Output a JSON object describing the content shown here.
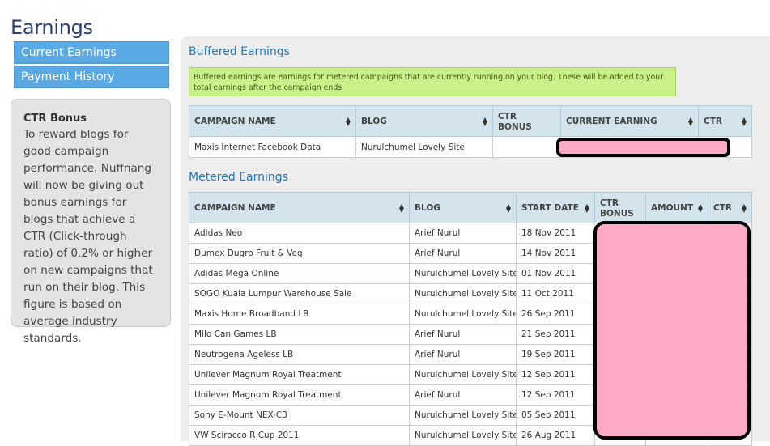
{
  "page": {
    "title": "Earnings"
  },
  "sidebar": {
    "items": [
      {
        "label": "Current Earnings"
      },
      {
        "label": "Payment History"
      }
    ]
  },
  "ctr_bonus": {
    "title": "CTR Bonus",
    "text": "To reward blogs for good campaign performance, Nuffnang will now be giving out bonus earnings for blogs that achieve a CTR (Click-through ratio) of 0.2% or higher on new campaigns that run on their blog. This figure is based on average industry standards."
  },
  "buffered": {
    "title": "Buffered Earnings",
    "info": "Buffered earnings are earnings for metered campaigns that are currently running on your blog. These will be added to your total earnings after the campaign ends",
    "columns": [
      "CAMPAIGN NAME",
      "BLOG",
      "CTR BONUS",
      "CURRENT EARNING",
      "CTR"
    ],
    "rows": [
      {
        "campaign": "Maxis Internet Facebook Data",
        "blog": "Nurulchumel Lovely Site"
      }
    ]
  },
  "metered": {
    "title": "Metered Earnings",
    "columns": [
      "CAMPAIGN NAME",
      "BLOG",
      "START DATE",
      "CTR BONUS",
      "AMOUNT",
      "CTR"
    ],
    "rows": [
      {
        "campaign": "Adidas Neo",
        "blog": "Arief Nurul",
        "start": "18 Nov 2011"
      },
      {
        "campaign": "Dumex Dugro Fruit & Veg",
        "blog": "Arief Nurul",
        "start": "14 Nov 2011"
      },
      {
        "campaign": "Adidas Mega Online",
        "blog": "Nurulchumel Lovely Site",
        "start": "01 Nov 2011"
      },
      {
        "campaign": "SOGO Kuala Lumpur Warehouse Sale",
        "blog": "Nurulchumel Lovely Site",
        "start": "11 Oct 2011"
      },
      {
        "campaign": "Maxis Home Broadband LB",
        "blog": "Nurulchumel Lovely Site",
        "start": "26 Sep 2011"
      },
      {
        "campaign": "Milo Can Games LB",
        "blog": "Arief Nurul",
        "start": "21 Sep 2011"
      },
      {
        "campaign": "Neutrogena Ageless LB",
        "blog": "Arief Nurul",
        "start": "19 Sep 2011"
      },
      {
        "campaign": "Unilever Magnum Royal Treatment",
        "blog": "Nurulchumel Lovely Site",
        "start": "12 Sep 2011"
      },
      {
        "campaign": "Unilever Magnum Royal Treatment",
        "blog": "Arief Nurul",
        "start": "12 Sep 2011"
      },
      {
        "campaign": "Sony E-Mount NEX-C3",
        "blog": "Nurulchumel Lovely Site",
        "start": "05 Sep 2011"
      },
      {
        "campaign": "VW Scirocco R Cup 2011",
        "blog": "Nurulchumel Lovely Site",
        "start": "26 Aug 2011"
      }
    ]
  },
  "colors": {
    "title": "#2a3f6e",
    "nav": "#5aa9e4",
    "section": "#2574b6",
    "info_bg": "#ccf089",
    "header_bg": "#d4e4ed",
    "redaction": "#ffabc8"
  }
}
